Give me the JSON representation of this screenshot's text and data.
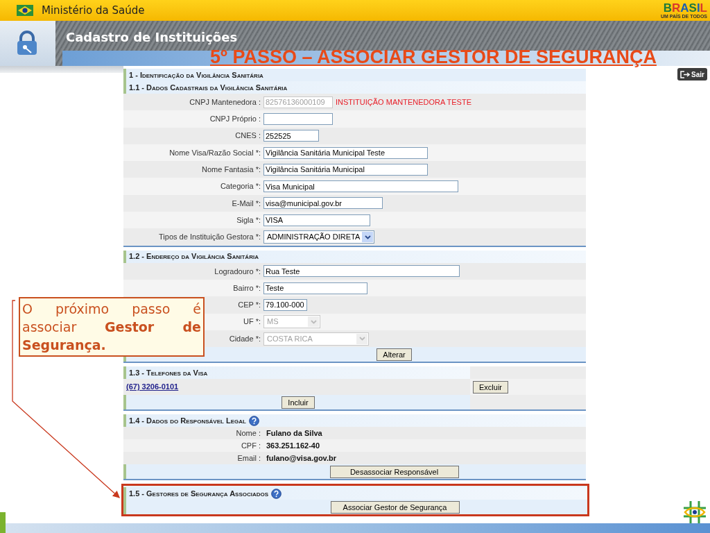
{
  "ministry": "Ministério da Saúde",
  "brand_logo": {
    "letters": [
      "B",
      "R",
      "A",
      "S",
      "I",
      "L"
    ],
    "tagline": "UM PAÍS DE TODOS"
  },
  "app_title": "Cadastro de Instituições",
  "slide_title": "5º PASSO – ASSOCIAR GESTOR DE SEGURANÇA",
  "logout_button": "Sair",
  "main_heading": "1 - Identificação da Vigilância Sanitária",
  "sections": [
    {
      "kind": "form",
      "title": "1.1 - Dados Cadastrais da Vigilância Sanitária",
      "help": false,
      "highlighted": false,
      "fields": [
        {
          "label": "CNPJ Mantenedora :",
          "kind": "text",
          "value": "82576136000109",
          "disabled": true,
          "note": "INSTITUIÇÃO MANTENEDORA TESTE"
        },
        {
          "label": "CNPJ Próprio :",
          "kind": "text",
          "disabled": false
        },
        {
          "label": "CNES :",
          "kind": "text",
          "value": "252525",
          "disabled": false
        },
        {
          "label": "Nome Visa/Razão Social *:",
          "kind": "text",
          "value": "Vigilância Sanitária Municipal Teste",
          "disabled": false
        },
        {
          "label": "Nome Fantasia *:",
          "kind": "text",
          "value": "Vigilância Sanitária Municipal",
          "disabled": false
        },
        {
          "label": "Categoria *:",
          "kind": "text",
          "value": "Visa Municipal",
          "disabled": false
        },
        {
          "label": "E-Mail *:",
          "kind": "text",
          "value": "visa@municipal.gov.br",
          "disabled": false
        },
        {
          "label": "Sigla *:",
          "kind": "text",
          "value": "VISA",
          "disabled": false
        },
        {
          "label": "Tipos de Instituição Gestora *:",
          "kind": "select",
          "value": "ADMINISTRAÇÃO DIRETA",
          "disabled": false
        }
      ]
    },
    {
      "kind": "form",
      "title": "1.2 - Endereço da Vigilância Sanitária",
      "help": false,
      "highlighted": false,
      "fields": [
        {
          "label": "Logradouro *:",
          "kind": "text",
          "value": "Rua Teste",
          "disabled": false
        },
        {
          "label": "Bairro *:",
          "kind": "text",
          "value": "Teste",
          "disabled": false
        },
        {
          "label": "CEP *:",
          "kind": "text",
          "value": "79.100-000",
          "disabled": false
        },
        {
          "label": "UF *:",
          "kind": "select",
          "value": "MS",
          "disabled": true
        },
        {
          "label": "Cidade *:",
          "kind": "select",
          "value": "COSTA RICA",
          "disabled": true
        }
      ],
      "button": "Alterar"
    },
    {
      "kind": "phones",
      "title": "1.3 - Telefones da Visa",
      "help": false,
      "highlighted": false,
      "phones": [
        {
          "number": "(67) 3206-0101",
          "action": "Excluir"
        }
      ],
      "button": "Incluir"
    },
    {
      "kind": "info",
      "title": "1.4 - Dados do Responsável Legal",
      "help": true,
      "highlighted": false,
      "rows": [
        {
          "label": "Nome :",
          "value": "Fulano da Silva"
        },
        {
          "label": "CPF :",
          "value": "363.251.162-40"
        },
        {
          "label": "Email :",
          "value": "fulano@visa.gov.br"
        }
      ],
      "button": "Desassociar Responsável"
    },
    {
      "kind": "info",
      "title": "1.5 - Gestores de Segurança Associados",
      "help": true,
      "highlighted": true,
      "button": "Associar Gestor de Segurança"
    }
  ],
  "callout": "O próximo passo é associar **Gestor de Segurança.**"
}
